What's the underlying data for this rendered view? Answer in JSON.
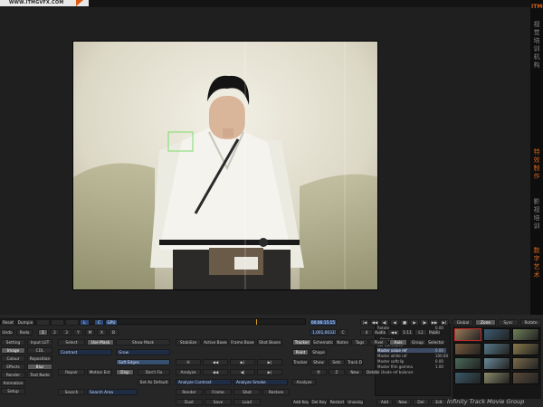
{
  "site_tab": "WWW.ITMGVFX.COM",
  "brand": {
    "logo": "ITMG",
    "chars": [
      "视",
      "觉",
      "培",
      "训",
      "机",
      "构",
      "特",
      "效",
      "制",
      "作",
      "影",
      "视",
      "培",
      "训",
      "数",
      "字",
      "艺",
      "术"
    ]
  },
  "timeline": {
    "frame_field": "00:06:15:15",
    "frame_field2": "1,001,00331",
    "left": [
      "Reset",
      "Dumpie",
      "",
      "",
      "",
      "L",
      "C",
      "GPU"
    ],
    "undo": "Undo",
    "redo": "Redo",
    "modes": [
      "1",
      "2",
      "3",
      "Y",
      "M",
      "X",
      "B"
    ]
  },
  "transport": {
    "buttons": [
      "|◀",
      "◀◀",
      "◀|",
      "◀",
      "■",
      "▶",
      "|▶",
      "▶▶",
      "▶|"
    ],
    "right": [
      "4",
      "Audio",
      "◀◀",
      "1:11",
      "L1",
      "Publish"
    ],
    "chips": [
      "C"
    ]
  },
  "menus": {
    "left": [
      "Setting",
      "Image",
      "Colour",
      "Effects",
      "Render",
      "Animation",
      "Setup"
    ],
    "second": [
      "Input LUT",
      "CDL",
      "Reposition",
      "Blur",
      "Text Node",
      "",
      ""
    ]
  },
  "actions": {
    "select": "Select",
    "use_mask": "Use Mask",
    "show_mask": "Show Mask",
    "contrast_label": "Contrast",
    "grow_label": "Grow",
    "grow_val": "0",
    "contrast_val": "0",
    "soft_edges": "Soft Edges",
    "soft_val": "0",
    "repair": "Repair",
    "motion_est": "Motion Est",
    "display": "Disp",
    "dont_fix": "Don't Fix",
    "set_default": "Set As Default",
    "search": "Search",
    "search_area": "Search Area",
    "search_val": "40"
  },
  "stabilize": {
    "top": [
      "Stabilize",
      "Active Boxes",
      "Frame Boxes",
      "Shot Boxes"
    ],
    "analyze": "Analyze",
    "contrast_field": "Analyze Contrast",
    "contrast_val": "30",
    "smoke_field": "Analyze Smoke",
    "smoke_val": "0",
    "bottom1": [
      "Render",
      "Frame",
      "Shot",
      "Restore"
    ],
    "bottom2": [
      "Dust",
      "Save",
      "Load",
      ""
    ],
    "arrows": [
      "H",
      "◀◀",
      "▶|",
      "▶|"
    ],
    "arrows2": [
      "◀◀",
      "◀|",
      "▶|"
    ]
  },
  "tracker": {
    "tabs": [
      "Tracker",
      "Schematic",
      "Notes",
      "Tags",
      "Pixel",
      "Axis",
      "Group",
      "Selector"
    ],
    "row2": [
      "Point",
      "Shape"
    ],
    "row3": [
      "Tracker",
      "Show",
      "Sets",
      "Track Down"
    ],
    "row4": [
      "Ⓡ",
      "Z",
      "New",
      "Delete"
    ],
    "analyze": "Analyze",
    "bottom": [
      "Add Key",
      "Del Key",
      "Restart",
      "Unassign"
    ]
  },
  "properties": {
    "header_left": "Rotate",
    "header_val": "0.00",
    "rows": [
      {
        "label": "Track",
        "v": ""
      },
      {
        "label": "▸ Primary",
        "v": ""
      },
      {
        "label": "  Col Correction",
        "v": ""
      },
      {
        "label": "  Master value ref",
        "v": "0.00"
      },
      {
        "label": "  Master white ref",
        "v": "100.00"
      },
      {
        "label": "  Master softclip",
        "v": "0.00"
      },
      {
        "label": "  Master film gamma",
        "v": "1.00"
      },
      {
        "label": "▸ Shade ref balance",
        "v": ""
      }
    ],
    "buttons": [
      "Add",
      "New",
      "Del",
      "Edt"
    ],
    "tool_btns": [
      "Global",
      "Zone",
      "Sync",
      "Rotate"
    ]
  },
  "thumbs": {
    "colors": [
      "#9a7a58",
      "#3c5a72",
      "#6f7f58",
      "#7a5a3c",
      "#567a8a",
      "#8a7a4a",
      "#4a6a5a",
      "#6a8a9a",
      "#7a6a4a",
      "#3a5a6a",
      "#8a8a6a",
      "#5a4a3a"
    ]
  },
  "watermark": "Infinity Track Movie Group"
}
